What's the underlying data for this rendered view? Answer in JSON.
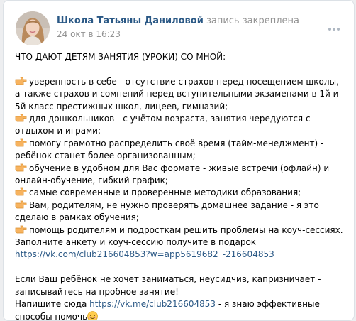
{
  "post": {
    "author": "Школа Татьяны Даниловой",
    "status": "запись закреплена",
    "date": "24 окт в 16:23",
    "intro": "ЧТО ДАЮТ ДЕТЯМ ЗАНЯТИЯ (УРОКИ) СО МНОЙ:",
    "bullets": [
      "уверенность в себе - отсутствие страхов перед посещением школы, а также страхов и сомнений перед вступительными экзаменами в 1й и 5й класс престижных школ, лицеев, гимназий;",
      "для дошкольников - с учётом возраста, занятия чередуются с отдыхом и играми;",
      "помогу грамотно распределить своё время (тайм-менеджмент) - ребёнок станет более организованным;",
      "обучение в удобном для Вас формате - живые встречи (офлайн) и онлайн-обучение, гибкий график;",
      "самые современные и проверенные методики образования;",
      "Вам, родителям, не нужно проверять домашнее задание - я это сделаю в рамках обучения;",
      "помощь родителям и подросткам решить проблемы на коуч-сессиях."
    ],
    "form_text": "Заполните анкету и коуч-сессию получите в подарок",
    "form_link": "https://vk.com/club216604853?w=app5619682_-216604853",
    "cta_text": "Если Ваш ребёнок не хочет заниматься, неусидчив, капризничает - записывайтесь на пробное занятие!",
    "write_prefix": "Напишите сюда ",
    "write_link": "https://vk.me/club216604853",
    "write_suffix": " - я знаю эффективные способы помочь",
    "icons": {
      "bullet": "backhand-index-pointing-right-icon",
      "emoji": "smiling-face-icon",
      "more": "more-options-icon"
    },
    "colors": {
      "link": "#2a5885",
      "meta": "#939393"
    }
  }
}
